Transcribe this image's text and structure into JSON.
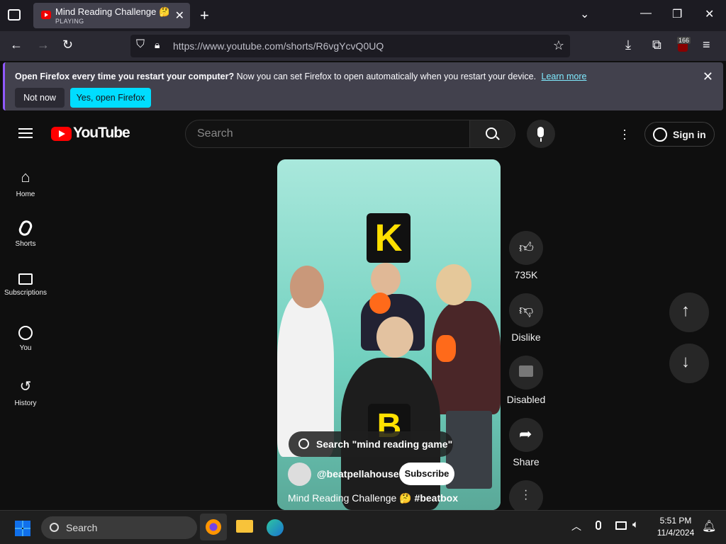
{
  "browser": {
    "tab": {
      "title": "Mind Reading Challenge 🤔 #beatbox",
      "status": "PLAYING"
    },
    "url": "https://www.youtube.com/shorts/R6vgYcvQ0UQ",
    "extension_badge": "166"
  },
  "notification": {
    "bold": "Open Firefox every time you restart your computer?",
    "text": "Now you can set Firefox to open automatically when you restart your device.",
    "link": "Learn more",
    "not_now": "Not now",
    "yes": "Yes, open Firefox"
  },
  "youtube": {
    "logo_text": "YouTube",
    "search_placeholder": "Search",
    "sign_in": "Sign in",
    "sidebar": [
      {
        "label": "Home"
      },
      {
        "label": "Shorts"
      },
      {
        "label": "Subscriptions"
      },
      {
        "label": "You"
      },
      {
        "label": "History"
      }
    ]
  },
  "video": {
    "card_top": "K",
    "card_bottom": "B",
    "search_suggestion": "Search \"mind reading game\"",
    "channel": "@beatpellahouse",
    "subscribe": "Subscribe",
    "title_plain": "Mind Reading Challenge 🤔",
    "title_tag": "#beatbox",
    "actions": {
      "likes": "735K",
      "dislike": "Dislike",
      "comments": "Disabled",
      "share": "Share"
    }
  },
  "taskbar": {
    "search": "Search",
    "time": "5:51 PM",
    "date": "11/4/2024"
  }
}
